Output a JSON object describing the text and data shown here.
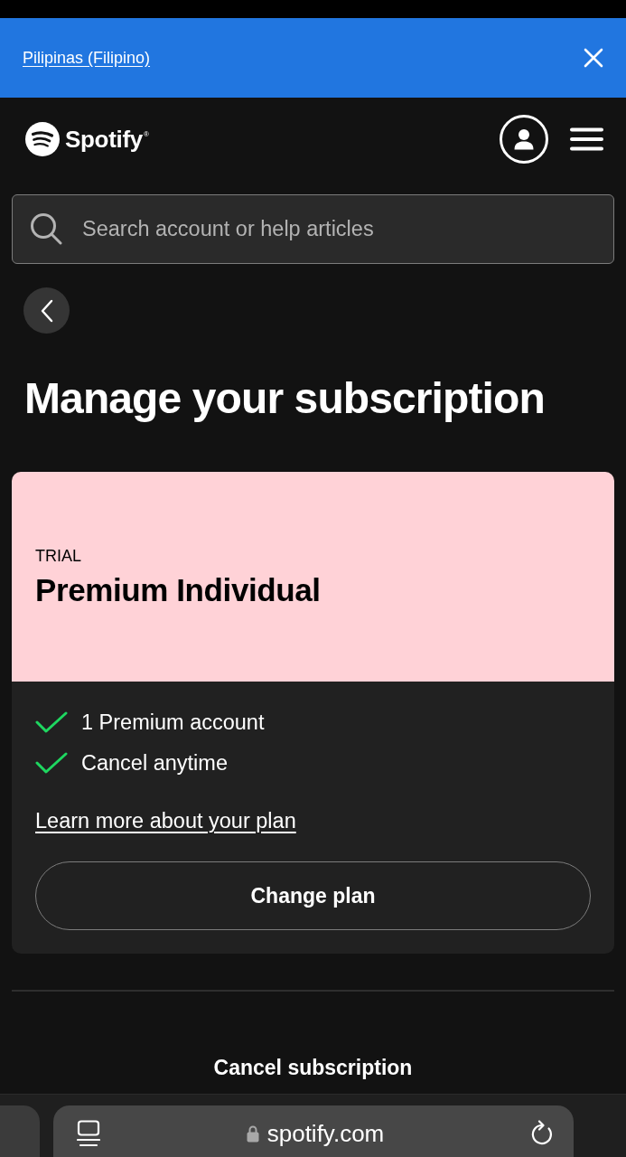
{
  "banner": {
    "link": "Pilipinas (Filipino)"
  },
  "header": {
    "brand": "Spotify$^{®}$"
  },
  "search": {
    "placeholder": "Search account or help articles"
  },
  "page": {
    "title": "Manage your subscription"
  },
  "plan": {
    "label": "TRIAL",
    "name": "Premium Individual",
    "features": [
      {
        "text": "1 Premium account",
        "included": true
      },
      {
        "text": "Cancel anytime",
        "included": true
      }
    ],
    "link": "Learn more about your plan",
    "button": "Change plan"
  },
  "actions": [
    {
      "label": "Cancel subscription"
    }
  ],
  "browser": {
    "url": "spotify.com"
  }
}
